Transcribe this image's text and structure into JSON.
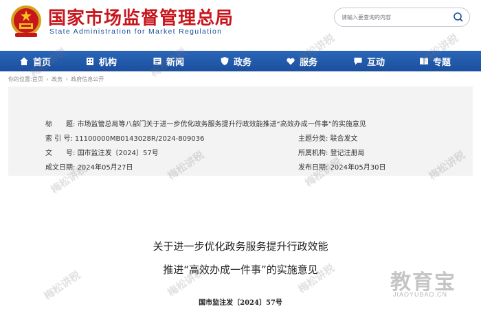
{
  "header": {
    "title_cn": "国家市场监督管理总局",
    "title_en": "State Administration for Market Regulation",
    "search": {
      "placeholder": "请输入要查询的内容"
    }
  },
  "nav": {
    "items": [
      {
        "label": "首页",
        "icon": "home-icon"
      },
      {
        "label": "机构",
        "icon": "building-icon"
      },
      {
        "label": "新闻",
        "icon": "newspaper-icon"
      },
      {
        "label": "政务",
        "icon": "shield-icon"
      },
      {
        "label": "服务",
        "icon": "heart-icon"
      },
      {
        "label": "互动",
        "icon": "chat-icon"
      },
      {
        "label": "专题",
        "icon": "book-icon"
      }
    ],
    "colors": {
      "bar": "#1c4f9e",
      "text": "#ffffff"
    }
  },
  "breadcrumb": [
    "你的位置:首页",
    "政务",
    "政府信息公开"
  ],
  "meta": {
    "title_label": "标　　题:",
    "title_value": "市场监管总局等八部门关于进一步优化政务服务提升行政效能推进“高效办成一件事”的实施意见",
    "index_label": "索 引 号:",
    "index_value": "11100000MB0143028R/2024-809036",
    "category_label": "主题分类:",
    "category_value": "联合发文",
    "docno_label": "文　　号:",
    "docno_value": "国市监注发〔2024〕57号",
    "org_label": "所属机构:",
    "org_value": "登记注册局",
    "date_label": "成文日期:",
    "date_value": "2024年05月27日",
    "pub_label": "发布日期:",
    "pub_value": "2024年05月30日"
  },
  "document": {
    "title_line1": "关于进一步优化政务服务提升行政效能",
    "title_line2": "推进“高效办成一件事”的实施意见",
    "number": "国市监注发〔2024〕57号"
  },
  "watermark": {
    "text": "梅松讲税",
    "brand": "教育宝",
    "brand_url": "JIAOYUBAO.CN"
  },
  "colors": {
    "brand_red": "#c8161d",
    "brand_blue": "#1a4f9c"
  }
}
